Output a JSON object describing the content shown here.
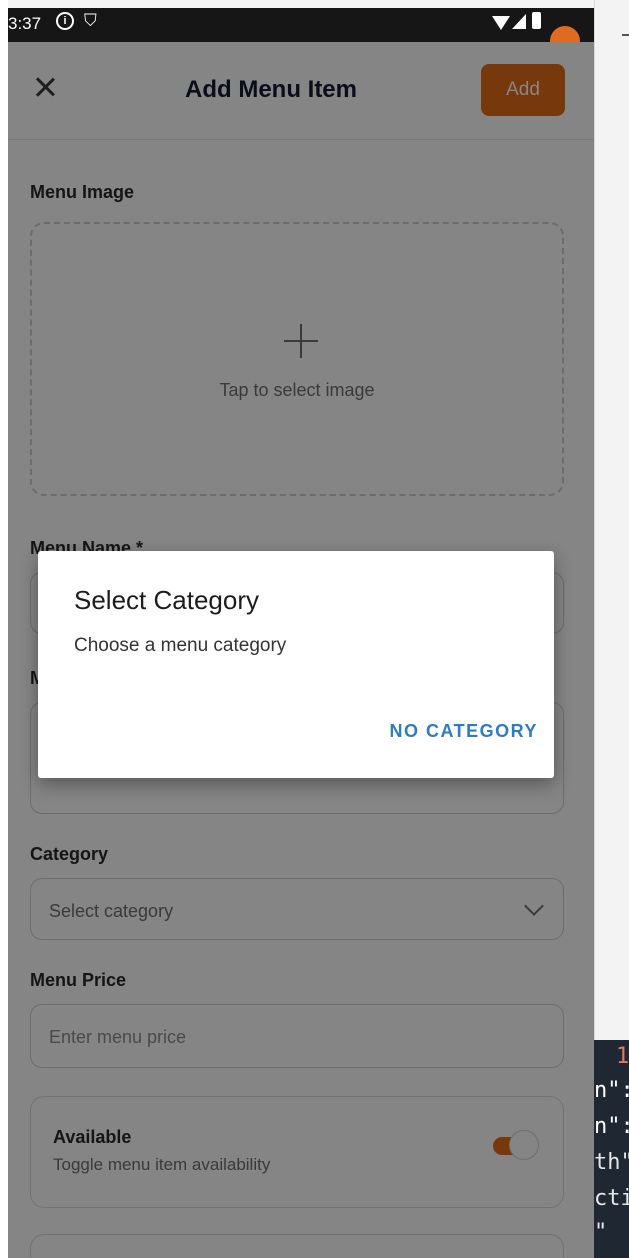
{
  "status_bar": {
    "time": "3:37",
    "info_icon": "info-icon",
    "shield_icon": "shield-icon"
  },
  "header": {
    "title": "Add Menu Item",
    "add_label": "Add",
    "close_icon": "close-icon"
  },
  "form": {
    "menu_image_label": "Menu Image",
    "image_picker_text": "Tap to select image",
    "menu_name_label": "Menu Name *",
    "description_label_partial": "M",
    "category_label": "Category",
    "category_value": "Select category",
    "price_label": "Menu Price",
    "price_placeholder": "Enter menu price",
    "available_title": "Available",
    "available_subtitle": "Toggle menu item availability",
    "available_on": true
  },
  "dialog": {
    "title": "Select Category",
    "message": "Choose a menu category",
    "button": "NO CATEGORY"
  },
  "code_fragments": [
    "1",
    "n\":",
    "n\":",
    "th\"",
    "cti",
    " \""
  ],
  "colors": {
    "accent": "#e56d18",
    "dialog_button": "#2f7cc4",
    "code_bg": "#1f2733"
  }
}
